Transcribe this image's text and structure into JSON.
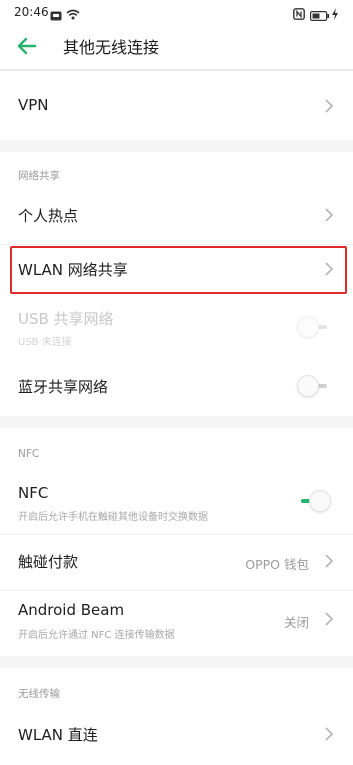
{
  "status_bar": {
    "time": "20:46",
    "icons": [
      "message-icon",
      "wifi-icon",
      "nfc-icon",
      "battery-icon",
      "charging-icon"
    ]
  },
  "header": {
    "title": "其他无线连接",
    "back_icon": "back-arrow-icon"
  },
  "items": {
    "vpn": {
      "label": "VPN"
    },
    "hotspot_section": "网络共享",
    "personal_hotspot": {
      "label": "个人热点"
    },
    "wlan_share": {
      "label": "WLAN 网络共享"
    },
    "usb_share": {
      "label": "USB 共享网络",
      "subtitle": "USB 未连接",
      "enabled": false,
      "toggle_on": false
    },
    "bt_share": {
      "label": "蓝牙共享网络",
      "toggle_on": false
    },
    "nfc_section": "NFC",
    "nfc": {
      "label": "NFC",
      "subtitle": "开启后允许手机在触碰其他设备时交换数据",
      "toggle_on": true
    },
    "tap_pay": {
      "label": "触碰付款",
      "value": "OPPO 钱包"
    },
    "android_beam": {
      "label": "Android Beam",
      "subtitle": "开启后允许通过 NFC 连接传输数据",
      "value": "关闭"
    },
    "wireless_section": "无线传输",
    "wlan_direct": {
      "label": "WLAN 直连"
    }
  },
  "colors": {
    "accent": "#27b36d",
    "highlight": "#e02b2b"
  }
}
